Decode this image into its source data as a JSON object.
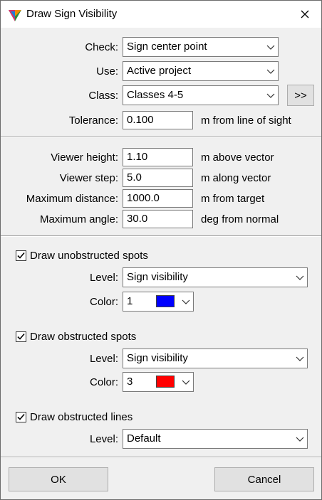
{
  "window": {
    "title": "Draw Sign Visibility"
  },
  "check": {
    "label": "Check:",
    "value": "Sign center point"
  },
  "use": {
    "label": "Use:",
    "value": "Active project"
  },
  "class": {
    "label": "Class:",
    "value": "Classes 4-5",
    "more_label": ">>"
  },
  "tolerance": {
    "label": "Tolerance:",
    "value": "0.100",
    "suffix": "m from line of sight"
  },
  "viewer_height": {
    "label": "Viewer height:",
    "value": "1.10",
    "suffix": "m above vector"
  },
  "viewer_step": {
    "label": "Viewer step:",
    "value": "5.0",
    "suffix": "m along vector"
  },
  "max_distance": {
    "label": "Maximum distance:",
    "value": "1000.0",
    "suffix": "m from target"
  },
  "max_angle": {
    "label": "Maximum angle:",
    "value": "30.0",
    "suffix": "deg from normal"
  },
  "unobstructed": {
    "label": "Draw unobstructed spots",
    "checked": true,
    "level_label": "Level:",
    "level_value": "Sign visibility",
    "color_label": "Color:",
    "color_value": "1",
    "color_hex": "#0000ff"
  },
  "obstructed": {
    "label": "Draw obstructed spots",
    "checked": true,
    "level_label": "Level:",
    "level_value": "Sign visibility",
    "color_label": "Color:",
    "color_value": "3",
    "color_hex": "#ff0000"
  },
  "obstructed_lines": {
    "label": "Draw obstructed lines",
    "checked": true,
    "level_label": "Level:",
    "level_value": "Default"
  },
  "footer": {
    "ok_label": "OK",
    "cancel_label": "Cancel"
  }
}
